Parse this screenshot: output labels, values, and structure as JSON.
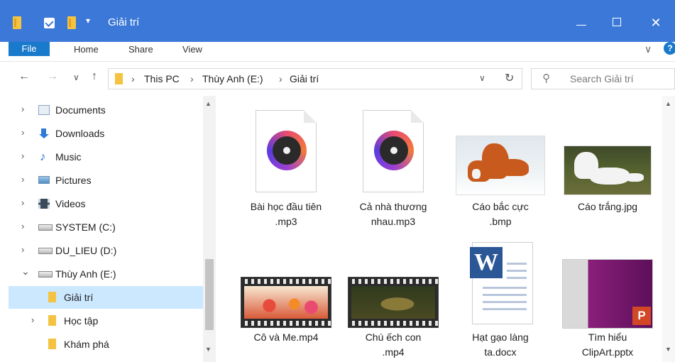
{
  "window": {
    "title": "Giải trí",
    "minimize_glyph": "—",
    "close_glyph": "✕"
  },
  "ribbon": {
    "tabs": [
      "File",
      "Home",
      "Share",
      "View"
    ],
    "expand_glyph": "∨",
    "help_glyph": "?"
  },
  "address": {
    "back_glyph": "←",
    "forward_glyph": "→",
    "recent_glyph": "∨",
    "up_glyph": "↑",
    "breadcrumb": [
      "This PC",
      "Thùy Anh (E:)",
      "Giải trí"
    ],
    "separator": "›",
    "dropdown_glyph": "∨",
    "refresh_glyph": "↻"
  },
  "search": {
    "placeholder": "Search Giải trí",
    "glyph": "⚲"
  },
  "nav": {
    "items": [
      {
        "label": "Documents",
        "icon": "documents-icon",
        "chevron": "›"
      },
      {
        "label": "Downloads",
        "icon": "downloads-icon",
        "chevron": "›"
      },
      {
        "label": "Music",
        "icon": "music-icon",
        "chevron": "›"
      },
      {
        "label": "Pictures",
        "icon": "pictures-icon",
        "chevron": "›"
      },
      {
        "label": "Videos",
        "icon": "videos-icon",
        "chevron": "›"
      },
      {
        "label": "SYSTEM (C:)",
        "icon": "drive-icon",
        "chevron": "›"
      },
      {
        "label": "DU_LIEU (D:)",
        "icon": "drive-icon",
        "chevron": "›"
      },
      {
        "label": "Thùy Anh (E:)",
        "icon": "drive-icon",
        "chevron": "⌄"
      },
      {
        "label": "Giải trí",
        "icon": "folder-icon",
        "chevron": "",
        "selected": true
      },
      {
        "label": "Học tập",
        "icon": "folder-icon",
        "chevron": "›"
      },
      {
        "label": "Khám phá",
        "icon": "folder-icon",
        "chevron": ""
      }
    ]
  },
  "files": [
    {
      "line1": "Bài học đầu tiên",
      "line2": ".mp3",
      "type": "mp3"
    },
    {
      "line1": "Cả nhà thương",
      "line2": "nhau.mp3",
      "type": "mp3"
    },
    {
      "line1": "Cáo bắc cực",
      "line2": ".bmp",
      "type": "image"
    },
    {
      "line1": "Cáo trắng.jpg",
      "line2": "",
      "type": "image"
    },
    {
      "line1": "Cô và Me.mp4",
      "line2": "",
      "type": "video"
    },
    {
      "line1": "Chú ếch con",
      "line2": ".mp4",
      "type": "video"
    },
    {
      "line1": "Hạt gạo làng",
      "line2": "ta.docx",
      "type": "docx"
    },
    {
      "line1": "Tìm hiểu",
      "line2": "ClipArt.pptx",
      "type": "pptx"
    }
  ],
  "icons": {
    "word_letter": "W",
    "ppt_letter": "P"
  },
  "colors": {
    "titlebar": "#3b78d8",
    "file_tab": "#1979ca",
    "selection": "#cce8ff",
    "folder": "#f5c342"
  }
}
